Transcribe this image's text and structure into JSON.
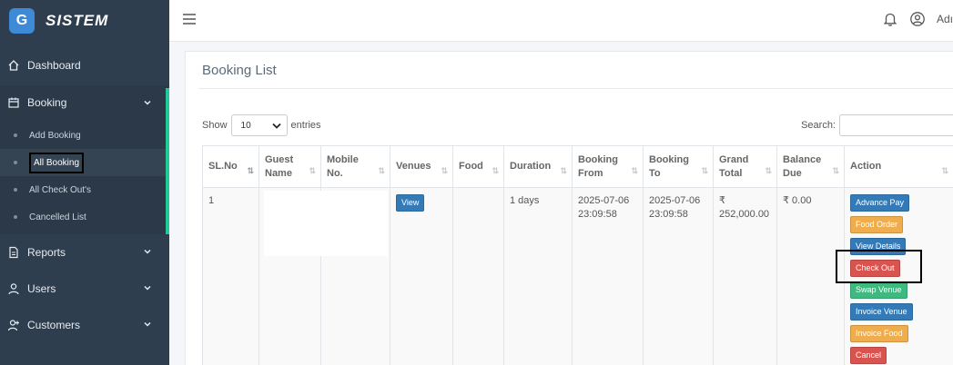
{
  "brand": {
    "logo_letter": "G",
    "name": "SISTEM"
  },
  "sidebar": {
    "items": [
      {
        "label": "Dashboard",
        "icon": "home-icon"
      },
      {
        "label": "Booking",
        "icon": "calendar-icon"
      },
      {
        "label": "Reports",
        "icon": "document-icon"
      },
      {
        "label": "Users",
        "icon": "user-icon"
      },
      {
        "label": "Customers",
        "icon": "user-plus-icon"
      }
    ],
    "booking_submenu": [
      {
        "label": "Add Booking"
      },
      {
        "label": "All Booking"
      },
      {
        "label": "All Check Out's"
      },
      {
        "label": "Cancelled List"
      }
    ]
  },
  "topbar": {
    "user_label": "Adı"
  },
  "page": {
    "title": "Booking List",
    "show_label": "Show",
    "entries_value": "10",
    "entries_label": "entries",
    "search_label": "Search:"
  },
  "table": {
    "headers": {
      "sl": "SL.No",
      "guest": [
        "Guest",
        "Name"
      ],
      "mobile": [
        "Mobile",
        "No."
      ],
      "venues": "Venues",
      "food": "Food",
      "duration": "Duration",
      "from": [
        "Booking",
        "From"
      ],
      "to": [
        "Booking",
        "To"
      ],
      "grand": [
        "Grand",
        "Total"
      ],
      "balance": [
        "Balance",
        "Due"
      ],
      "action": "Action"
    },
    "row": {
      "sl": "1",
      "venue_btn": "View",
      "duration": "1 days",
      "from_date": "2025-07-06",
      "from_time": "23:09:58",
      "to_date": "2025-07-06",
      "to_time": "23:09:58",
      "grand_1": "₹",
      "grand_2": "252,000.00",
      "balance": "₹ 0.00",
      "actions": {
        "advance_pay": "Advance Pay",
        "food_order": "Food Order",
        "view_details": "View Details",
        "check_out": "Check Out",
        "swap_venue": "Swap Venue",
        "invoice_venue": "Invoice Venue",
        "invoice_food": "Invoice Food",
        "cancel": "Cancel"
      }
    }
  },
  "colors": {
    "sidebar_bg": "#2f3e4e",
    "accent": "#20c997",
    "primary": "#337ab7",
    "warning": "#f0ad4e",
    "danger": "#d9534f",
    "success": "#3fb97f"
  }
}
